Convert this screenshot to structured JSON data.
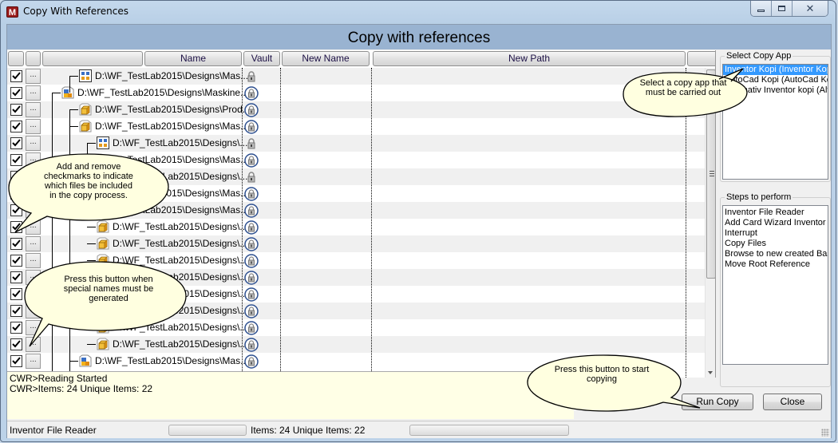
{
  "window": {
    "title": "Copy With References",
    "app_icon_letter": "M",
    "caption_buttons": {
      "minimize": "minimize-icon",
      "maximize": "maximize-icon",
      "close": "close-icon"
    }
  },
  "banner": {
    "title": "Copy with references"
  },
  "grid": {
    "columns": [
      {
        "key": "check",
        "label": ""
      },
      {
        "key": "action",
        "label": ""
      },
      {
        "key": "tree",
        "label": ""
      },
      {
        "key": "name",
        "label": "Name"
      },
      {
        "key": "vault",
        "label": "Vault"
      },
      {
        "key": "new_name",
        "label": "New Name"
      },
      {
        "key": "new_path",
        "label": "New Path"
      },
      {
        "key": "extra",
        "label": ""
      }
    ],
    "action_button_label": "...",
    "rows": [
      {
        "checked": true,
        "icon": "drawing-icon",
        "level": 3,
        "path": "D:\\WF_TestLab2015\\Designs\\Mas...",
        "vault": "lock-small-icon",
        "new_name": "",
        "new_path": ""
      },
      {
        "checked": true,
        "icon": "assembly-icon",
        "level": 2,
        "path": "D:\\WF_TestLab2015\\Designs\\Maskine...",
        "vault": "lock-circle-icon",
        "new_name": "",
        "new_path": ""
      },
      {
        "checked": true,
        "icon": "part-icon",
        "level": 3,
        "path": "D:\\WF_TestLab2015\\Designs\\Prod...",
        "vault": "lock-circle-icon",
        "new_name": "",
        "new_path": ""
      },
      {
        "checked": true,
        "icon": "part-icon",
        "level": 3,
        "path": "D:\\WF_TestLab2015\\Designs\\Mas...",
        "vault": "lock-circle-icon",
        "new_name": "",
        "new_path": ""
      },
      {
        "checked": true,
        "icon": "drawing-icon",
        "level": 4,
        "path": "D:\\WF_TestLab2015\\Designs\\...",
        "vault": "lock-small-icon",
        "new_name": "",
        "new_path": ""
      },
      {
        "checked": true,
        "icon": "assembly-icon",
        "level": 3,
        "path": "D:\\WF_TestLab2015\\Designs\\Mas...",
        "vault": "lock-circle-icon",
        "new_name": "",
        "new_path": ""
      },
      {
        "checked": true,
        "icon": "drawing-icon",
        "level": 4,
        "path": "D:\\WF_TestLab2015\\Designs\\...",
        "vault": "lock-small-icon",
        "new_name": "",
        "new_path": ""
      },
      {
        "checked": true,
        "icon": "assembly-icon",
        "level": 3,
        "path": "D:\\WF_TestLab2015\\Designs\\Mas...",
        "vault": "lock-circle-icon",
        "new_name": "",
        "new_path": ""
      },
      {
        "checked": true,
        "icon": "assembly-icon",
        "level": 3,
        "path": "D:\\WF_TestLab2015\\Designs\\Mas...",
        "vault": "lock-circle-icon",
        "new_name": "",
        "new_path": ""
      },
      {
        "checked": true,
        "icon": "part-icon",
        "level": 4,
        "path": "D:\\WF_TestLab2015\\Designs\\...",
        "vault": "lock-circle-icon",
        "new_name": "",
        "new_path": ""
      },
      {
        "checked": true,
        "icon": "part-icon",
        "level": 4,
        "path": "D:\\WF_TestLab2015\\Designs\\...",
        "vault": "lock-circle-icon",
        "new_name": "",
        "new_path": ""
      },
      {
        "checked": true,
        "icon": "part-icon",
        "level": 4,
        "path": "D:\\WF_TestLab2015\\Designs\\...",
        "vault": "lock-circle-icon",
        "new_name": "",
        "new_path": ""
      },
      {
        "checked": true,
        "icon": "part-icon",
        "level": 4,
        "path": "D:\\WF_TestLab2015\\Designs\\...",
        "vault": "lock-circle-icon",
        "new_name": "",
        "new_path": ""
      },
      {
        "checked": true,
        "icon": "part-icon",
        "level": 4,
        "path": "D:\\WF_TestLab2015\\Designs\\...",
        "vault": "lock-circle-icon",
        "new_name": "",
        "new_path": ""
      },
      {
        "checked": true,
        "icon": "part-icon",
        "level": 4,
        "path": "D:\\WF_TestLab2015\\Designs\\...",
        "vault": "lock-circle-icon",
        "new_name": "",
        "new_path": ""
      },
      {
        "checked": true,
        "icon": "part-icon",
        "level": 4,
        "path": "D:\\WF_TestLab2015\\Designs\\...",
        "vault": "lock-circle-icon",
        "new_name": "",
        "new_path": ""
      },
      {
        "checked": true,
        "icon": "part-icon",
        "level": 4,
        "path": "D:\\WF_TestLab2015\\Designs\\...",
        "vault": "lock-circle-icon",
        "new_name": "",
        "new_path": ""
      },
      {
        "checked": true,
        "icon": "assembly-icon",
        "level": 3,
        "path": "D:\\WF_TestLab2015\\Designs\\Mas...",
        "vault": "lock-circle-icon",
        "new_name": "",
        "new_path": ""
      }
    ]
  },
  "copy_app": {
    "group_label": "Select Copy App",
    "items": [
      {
        "label": "Inventor Kopi (Inventor Kopi)",
        "selected": true
      },
      {
        "label": "AutoCad Kopi (AutoCad Kopi)",
        "selected": false
      },
      {
        "label": "Alternativ Inventor kopi (Alternativ)",
        "selected": false
      }
    ]
  },
  "steps": {
    "group_label": "Steps to perform",
    "items": [
      "Inventor File Reader",
      "Add Card Wizard Inventor F",
      "Interrupt",
      "Copy Files",
      "Browse to new created Bas",
      "Move Root Reference"
    ]
  },
  "log": {
    "lines": [
      "CWR>Reading Started",
      "CWR>Items: 24 Unique Items: 22"
    ]
  },
  "buttons": {
    "run_copy": "Run Copy",
    "close": "Close"
  },
  "statusbar": {
    "step": "Inventor File Reader",
    "items_text": "Items: 24 Unique Items: 22",
    "progress1": 0,
    "progress2": 0
  },
  "callouts": {
    "select_app": "Select a copy app that must be carried out",
    "checkmarks": "Add and remove checkmarks to indicate which files be included in the copy process.",
    "special_names": "Press this button when special names must be generated",
    "run_copy": "Press this button to start copying"
  }
}
